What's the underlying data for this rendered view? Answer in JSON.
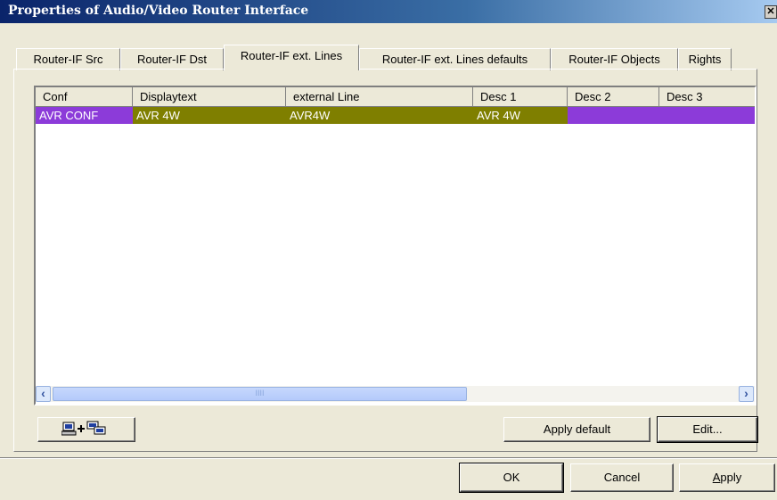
{
  "window": {
    "title": "Properties of Audio/Video Router Interface",
    "close_glyph": "✕"
  },
  "tabs": [
    {
      "label": "Router-IF Src",
      "active": false
    },
    {
      "label": "Router-IF Dst",
      "active": false
    },
    {
      "label": "Router-IF ext. Lines",
      "active": true
    },
    {
      "label": "Router-IF ext. Lines defaults",
      "active": false
    },
    {
      "label": "Router-IF Objects",
      "active": false
    },
    {
      "label": "Rights",
      "active": false
    }
  ],
  "grid": {
    "columns": [
      "Conf",
      "Displaytext",
      "external Line",
      "Desc 1",
      "Desc 2",
      "Desc 3"
    ],
    "rows": [
      {
        "cells": [
          "AVR CONF",
          "AVR 4W",
          "AVR4W",
          "AVR 4W",
          "",
          ""
        ]
      }
    ],
    "colors": {
      "conf_cell": "#8c3bd9",
      "highlight": "#7f7f00",
      "desc_empty": "#8c3bd9"
    },
    "scroll_left_glyph": "‹",
    "scroll_right_glyph": "›",
    "thumb_grip": "IIII"
  },
  "buttons": {
    "icon_button": "add-line-icon",
    "apply_default": "Apply default",
    "edit": "Edit...",
    "ok": "OK",
    "cancel": "Cancel",
    "apply_accel": "A",
    "apply_rest": "pply"
  }
}
